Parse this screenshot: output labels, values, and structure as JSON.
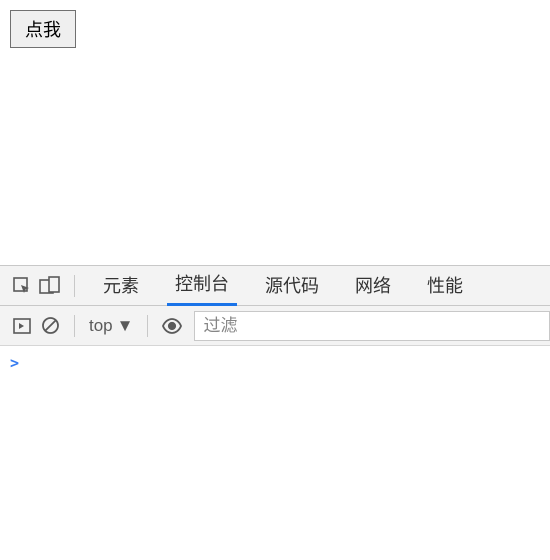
{
  "page": {
    "button_label": "点我"
  },
  "devtools": {
    "tabs": {
      "elements": "元素",
      "console": "控制台",
      "sources": "源代码",
      "network": "网络",
      "performance": "性能"
    },
    "console": {
      "context_label": "top",
      "filter_placeholder": "过滤",
      "prompt": ">"
    }
  }
}
